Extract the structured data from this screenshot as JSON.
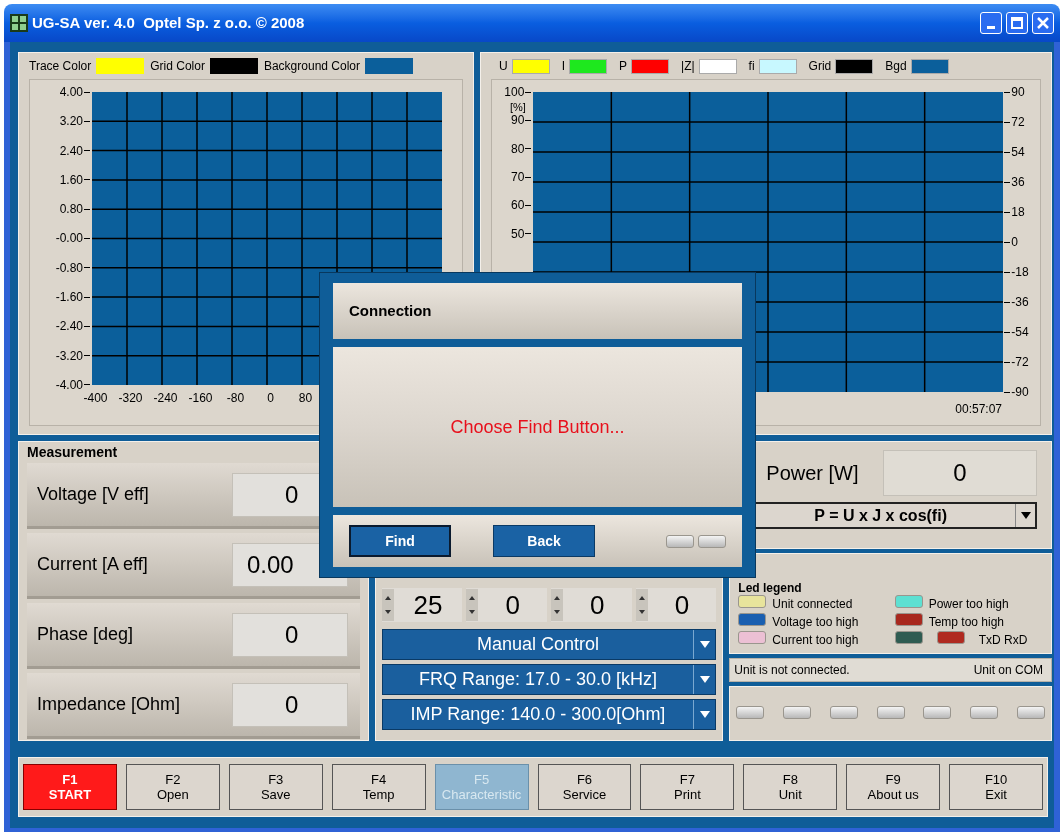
{
  "window": {
    "title": "UG-SA ver. 4.0  Optel Sp. z o.o. © 2008"
  },
  "trace_chart": {
    "legend": [
      {
        "label": "Trace Color",
        "color": "#ffff00"
      },
      {
        "label": "Grid Color",
        "color": "#000000"
      },
      {
        "label": "Background Color",
        "color": "#0b5f9b"
      }
    ],
    "y_ticks": [
      "4.00",
      "3.20",
      "2.40",
      "1.60",
      "0.80",
      "-0.00",
      "-0.80",
      "-1.60",
      "-2.40",
      "-3.20",
      "-4.00"
    ],
    "x_ticks": [
      "-400",
      "-320",
      "-240",
      "-160",
      "-80",
      "0",
      "80"
    ]
  },
  "trend_chart": {
    "legend": [
      {
        "label": "U",
        "color": "#ffff00"
      },
      {
        "label": "I",
        "color": "#1ee81e"
      },
      {
        "label": "P",
        "color": "#ff0000"
      },
      {
        "label": "|Z|",
        "color": "#ffffff"
      },
      {
        "label": "fi",
        "color": "#c8f8ff"
      },
      {
        "label": "Grid",
        "color": "#000000"
      },
      {
        "label": "Bgd",
        "color": "#0b5f9b"
      }
    ],
    "unit": "[%]",
    "left_ticks": [
      "100",
      "90",
      "80",
      "70",
      "60",
      "50"
    ],
    "right_ticks": [
      "90",
      "72",
      "54",
      "36",
      "18",
      "0",
      "-18",
      "-36",
      "-54",
      "-72",
      "-90"
    ],
    "time": "00:57:07"
  },
  "measurement": {
    "title": "Measurement",
    "rows": [
      {
        "label": "Voltage [V eff]",
        "value": "0"
      },
      {
        "label": "Current [A eff]",
        "value": "0.00"
      },
      {
        "label": "Phase [deg]",
        "value": "0"
      },
      {
        "label": "Impedance [Ohm]",
        "value": "0"
      }
    ]
  },
  "control": {
    "spinners": [
      "25",
      "0",
      "0",
      "0"
    ],
    "dropdowns": [
      "Manual Control",
      "FRQ Range: 17.0 - 30.0 [kHz]",
      "IMP Range: 140.0 - 300.0[Ohm]"
    ]
  },
  "power": {
    "label": "Power [W]",
    "value": "0",
    "formula": "P = U x J x cos(fi)"
  },
  "led_legend": {
    "title": "Led legend",
    "items": [
      {
        "label": "Unit connected",
        "leds": [
          {
            "color": "#e8e49c"
          }
        ]
      },
      {
        "label": "Power too high",
        "leds": [
          {
            "color": "#5ee0d2"
          }
        ]
      },
      {
        "label": "Voltage too high",
        "leds": [
          {
            "color": "#1a5fb0"
          }
        ]
      },
      {
        "label": "Temp too high",
        "leds": [
          {
            "color": "#a8281e"
          }
        ]
      },
      {
        "label": "Current too high",
        "leds": [
          {
            "color": "#ecc0d4"
          }
        ]
      },
      {
        "label": "TxD RxD",
        "leds": [
          {
            "color": "#2f5c52"
          },
          {
            "color": "#b02a20"
          }
        ]
      }
    ]
  },
  "status": {
    "message": "Unit is not connected.",
    "port": "Unit on COM"
  },
  "function_keys": [
    {
      "key": "F1",
      "label": "START",
      "active": true,
      "disabled": false
    },
    {
      "key": "F2",
      "label": "Open",
      "active": false,
      "disabled": false
    },
    {
      "key": "F3",
      "label": "Save",
      "active": false,
      "disabled": false
    },
    {
      "key": "F4",
      "label": "Temp",
      "active": false,
      "disabled": false
    },
    {
      "key": "F5",
      "label": "Characteristic",
      "active": false,
      "disabled": true
    },
    {
      "key": "F6",
      "label": "Service",
      "active": false,
      "disabled": false
    },
    {
      "key": "F7",
      "label": "Print",
      "active": false,
      "disabled": false
    },
    {
      "key": "F8",
      "label": "Unit",
      "active": false,
      "disabled": false
    },
    {
      "key": "F9",
      "label": "About us",
      "active": false,
      "disabled": false
    },
    {
      "key": "F10",
      "label": "Exit",
      "active": false,
      "disabled": false
    }
  ],
  "dialog": {
    "title": "Connection",
    "message": "Choose Find Button...",
    "buttons": [
      "Find",
      "Back"
    ]
  }
}
